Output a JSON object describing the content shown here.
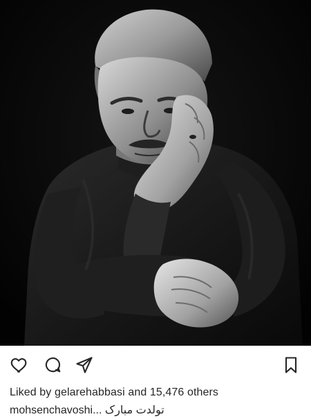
{
  "post": {
    "image_alt": "",
    "likes": {
      "prefix": "Liked by",
      "user": "gelarehabbasi",
      "joiner": "and",
      "others": "15,476 others"
    },
    "caption": {
      "username": "mohsenchavoshi",
      "ellipsis": "...",
      "text": "تولدت مبارک"
    }
  },
  "actions": {
    "icons": [
      "heart-icon",
      "comment-icon",
      "paper-plane-icon",
      "bookmark-icon"
    ],
    "icon_color": "#262626"
  },
  "colors": {
    "photo_background": "#050505",
    "text": "#262626",
    "page_background": "#ffffff"
  }
}
